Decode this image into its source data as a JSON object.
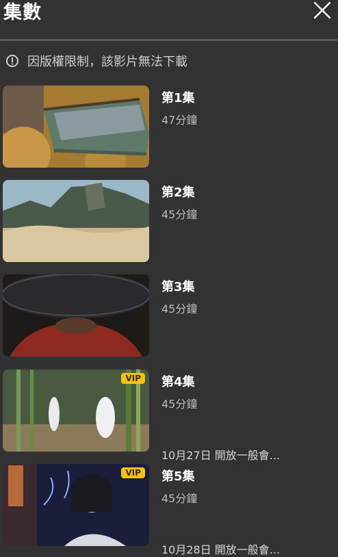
{
  "header": {
    "title": "集數",
    "close_icon": "close-icon"
  },
  "notice": {
    "icon": "exclamation-circle-icon",
    "text": "因版權限制，該影片無法下載"
  },
  "episodes": [
    {
      "title": "第1集",
      "duration": "47分鐘",
      "vip": "",
      "note": ""
    },
    {
      "title": "第2集",
      "duration": "45分鐘",
      "vip": "",
      "note": ""
    },
    {
      "title": "第3集",
      "duration": "45分鐘",
      "vip": "",
      "note": ""
    },
    {
      "title": "第4集",
      "duration": "45分鐘",
      "vip": "VIP",
      "note": "10月27日 開放一般會..."
    },
    {
      "title": "第5集",
      "duration": "45分鐘",
      "vip": "VIP",
      "note": "10月28日 開放一般會..."
    }
  ],
  "colors": {
    "background": "#323232",
    "vip_badge": "#f4c20d",
    "divider": "#5a5a5a"
  }
}
